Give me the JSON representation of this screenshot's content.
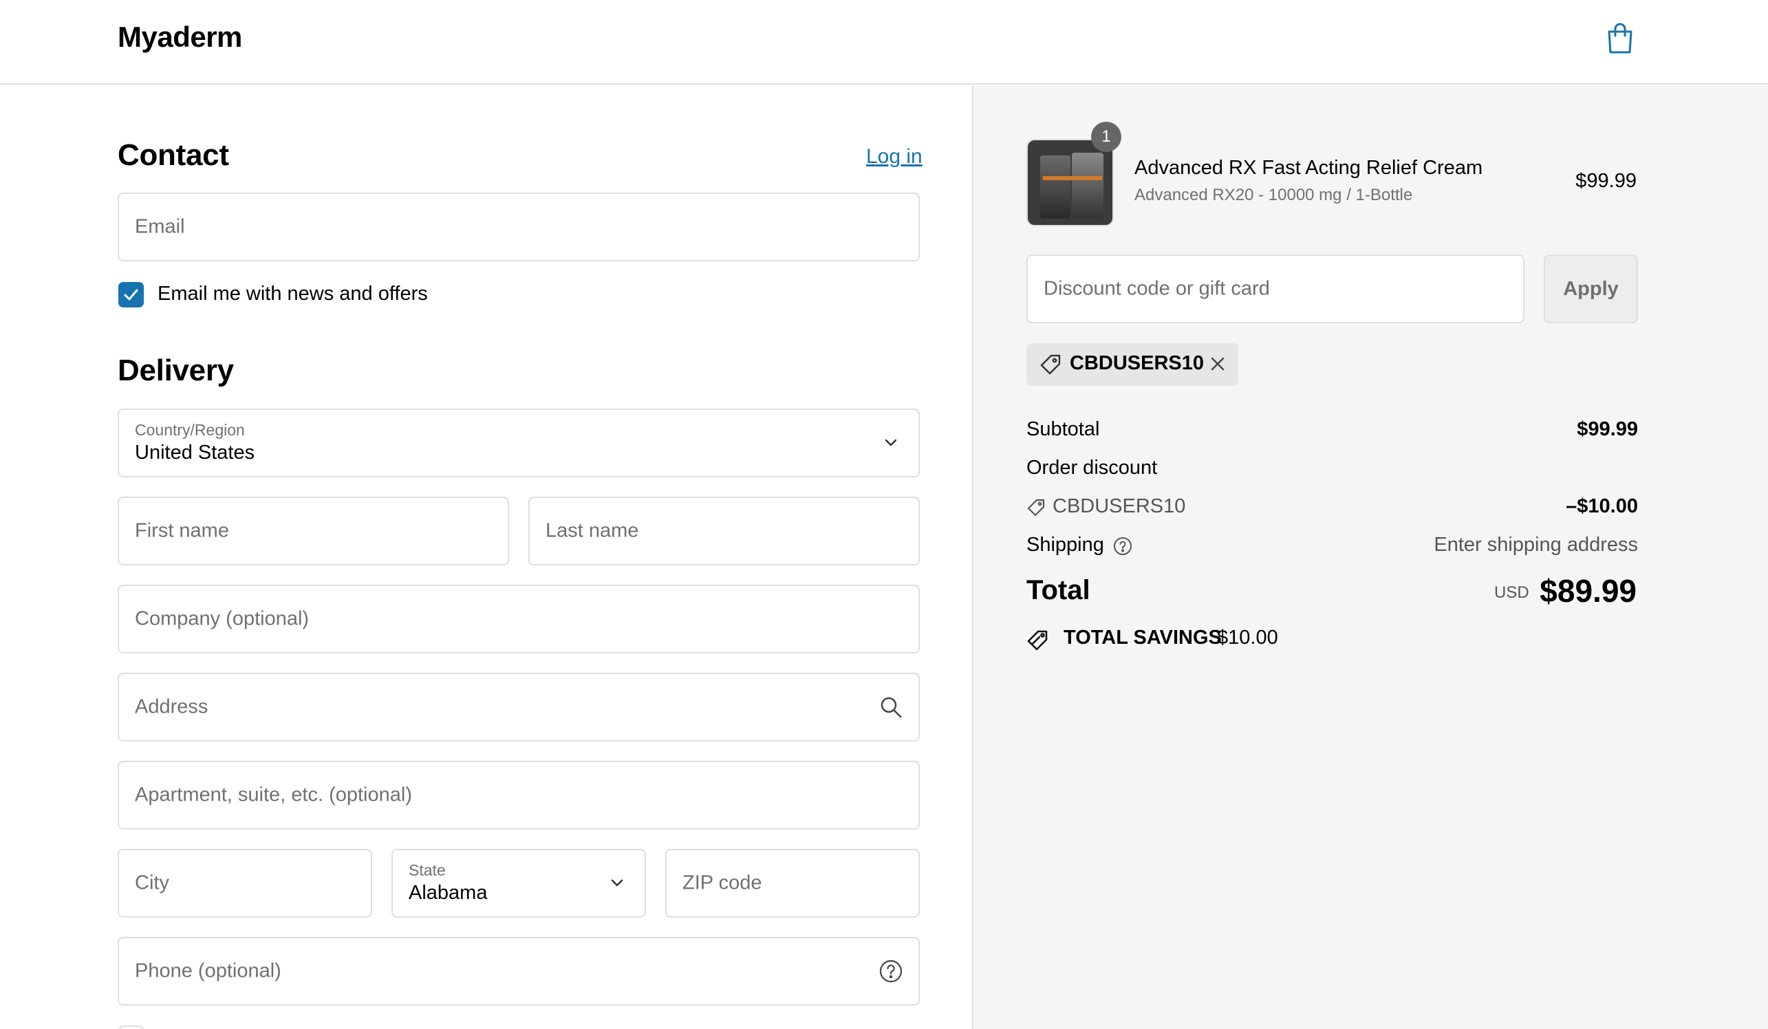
{
  "header": {
    "brand": "Myaderm",
    "cart_icon": "shopping-bag-icon"
  },
  "contact": {
    "title": "Contact",
    "login_link": "Log in",
    "email_placeholder": "Email",
    "news_checkbox_label": "Email me with news and offers",
    "news_checked": true
  },
  "delivery": {
    "title": "Delivery",
    "country_label": "Country/Region",
    "country_value": "United States",
    "first_name_placeholder": "First name",
    "last_name_placeholder": "Last name",
    "company_placeholder": "Company (optional)",
    "address_placeholder": "Address",
    "apartment_placeholder": "Apartment, suite, etc. (optional)",
    "city_placeholder": "City",
    "state_label": "State",
    "state_value": "Alabama",
    "zip_placeholder": "ZIP code",
    "phone_placeholder": "Phone (optional)"
  },
  "summary": {
    "item": {
      "quantity": "1",
      "title": "Advanced RX Fast Acting Relief Cream",
      "variant": "Advanced RX20 - 10000 mg / 1-Bottle",
      "price": "$99.99"
    },
    "discount_placeholder": "Discount code or gift card",
    "apply_label": "Apply",
    "applied_code": "CBDUSERS10",
    "subtotal_label": "Subtotal",
    "subtotal_value": "$99.99",
    "order_discount_label": "Order discount",
    "discount_code": "CBDUSERS10",
    "discount_value": "–$10.00",
    "shipping_label": "Shipping",
    "shipping_value": "Enter shipping address",
    "total_label": "Total",
    "total_currency": "USD",
    "total_value": "$89.99",
    "savings_label": "TOTAL SAVINGS",
    "savings_value": "$10.00"
  },
  "colors": {
    "accent": "#1773b0",
    "sidebar_bg": "#f5f5f5",
    "border": "#dedede"
  }
}
